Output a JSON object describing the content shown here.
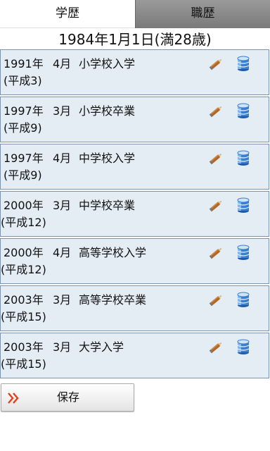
{
  "tabs": {
    "active": "学歴",
    "inactive": "職歴"
  },
  "birth_date": "1984年1月1日(満28歳)",
  "entries": [
    {
      "year": "1991年",
      "month": "4月",
      "event": "小学校入学",
      "era": "(平成3)"
    },
    {
      "year": "1997年",
      "month": "3月",
      "event": "小学校卒業",
      "era": "(平成9)"
    },
    {
      "year": "1997年",
      "month": "4月",
      "event": "中学校入学",
      "era": "(平成9)"
    },
    {
      "year": "2000年",
      "month": "3月",
      "event": "中学校卒業",
      "era": "(平成12)"
    },
    {
      "year": "2000年",
      "month": "4月",
      "event": "高等学校入学",
      "era": "(平成12)"
    },
    {
      "year": "2003年",
      "month": "3月",
      "event": "高等学校卒業",
      "era": "(平成15)"
    },
    {
      "year": "2003年",
      "month": "3月",
      "event": "大学入学",
      "era": "(平成15)"
    }
  ],
  "icons": {
    "edit": "pencil-icon",
    "save_record": "database-icon",
    "button": "double-chevron-right-icon"
  },
  "colors": {
    "row_bg": "#e4ecf4",
    "row_border": "#7d93ab",
    "chevron": "#e0401a",
    "pencil": "#b0682a",
    "db_blue": "#3a7fd0"
  },
  "save_button": {
    "label": "保存"
  }
}
